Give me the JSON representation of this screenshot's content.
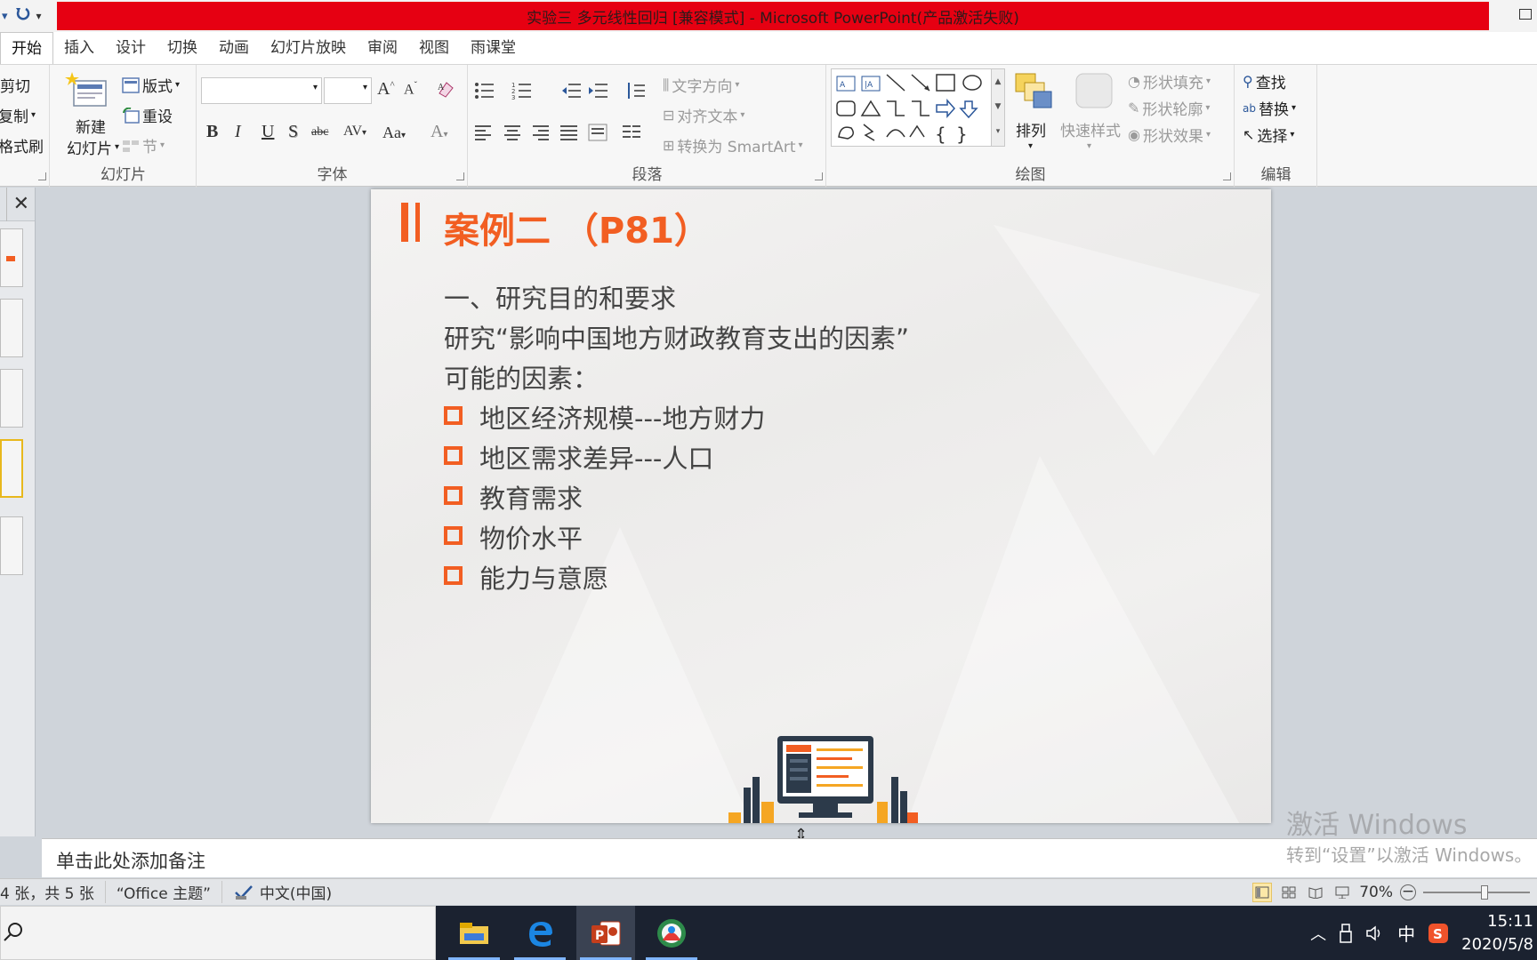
{
  "window": {
    "title": "实验三 多元线性回归 [兼容模式] - Microsoft PowerPoint(产品激活失败)"
  },
  "tabs": [
    "开始",
    "插入",
    "设计",
    "切换",
    "动画",
    "幻灯片放映",
    "审阅",
    "视图",
    "雨课堂"
  ],
  "ribbon": {
    "clipboard": {
      "cut": "剪切",
      "copy": "复制",
      "format_painter": "格式刷"
    },
    "slides": {
      "label": "幻灯片",
      "new_slide_1": "新建",
      "new_slide_2": "幻灯片",
      "layout": "版式",
      "reset": "重设",
      "section": "节"
    },
    "font": {
      "label": "字体",
      "bold": "B",
      "italic": "I",
      "underline": "U",
      "shadow": "S",
      "strike": "abc",
      "spacing": "AV",
      "case": "Aa",
      "grow": "A",
      "shrink": "A",
      "color": "A"
    },
    "paragraph": {
      "label": "段落",
      "text_direction": "文字方向",
      "align_text": "对齐文本",
      "smartart": "转换为 SmartArt"
    },
    "drawing": {
      "label": "绘图",
      "arrange": "排列",
      "quick_styles": "快速样式",
      "shape_fill": "形状填充",
      "shape_outline": "形状轮廓",
      "shape_effects": "形状效果"
    },
    "editing": {
      "label": "编辑",
      "find": "查找",
      "replace": "替换",
      "select": "选择"
    }
  },
  "slide": {
    "title": "案例二 （P81）",
    "line1": "一、研究目的和要求",
    "line2": "研究“影响中国地方财政教育支出的因素”",
    "line3": "可能的因素：",
    "bullets": [
      "地区经济规模---地方财力",
      "地区需求差异---人口",
      "教育需求",
      "物价水平",
      "能力与意愿"
    ]
  },
  "notes": {
    "placeholder": "单击此处添加备注"
  },
  "watermark": {
    "line1": "激活 Windows",
    "line2": "转到“设置”以激活 Windows。"
  },
  "status": {
    "slide_count": "4 张，共 5 张",
    "theme": "“Office 主题”",
    "language": "中文(中国)",
    "zoom": "70%",
    "zoom_fraction": 0.58
  },
  "taskbar": {
    "time": "15:11",
    "date": "2020/5/8",
    "ime": "中"
  },
  "colors": {
    "accent": "#f25e22",
    "title_bar": "#e60012"
  }
}
